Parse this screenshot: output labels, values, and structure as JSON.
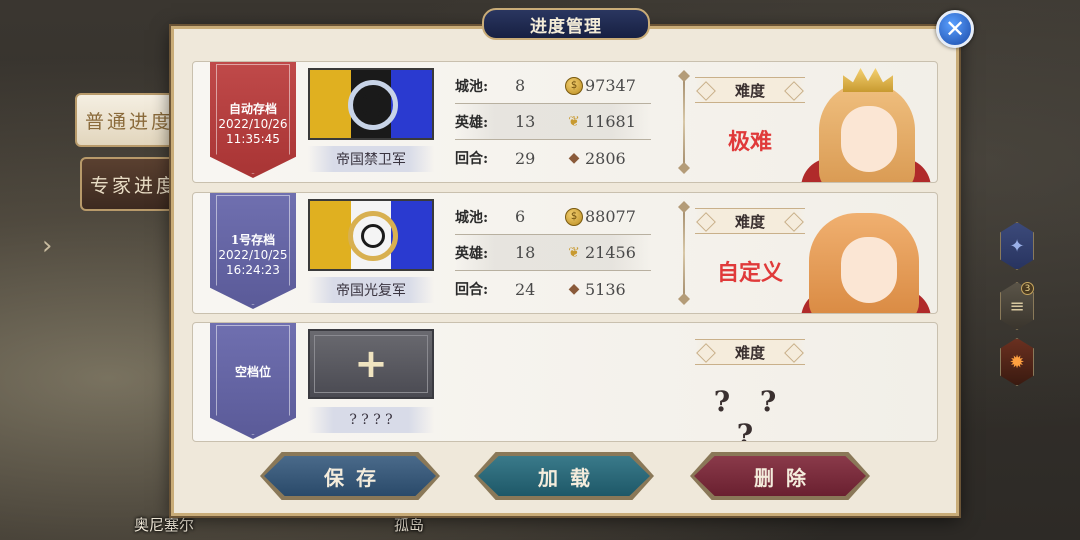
{
  "title": "进度管理",
  "close_icon": "close-icon",
  "side_tabs": {
    "normal": "普通进度",
    "expert": "专家进度"
  },
  "map_labels": {
    "city1": "奥尼塞尔",
    "city2": "孤岛"
  },
  "right_icons": {
    "sword": "sword-icon",
    "scroll": "scroll-icon",
    "scroll_badge": "3",
    "fire": "fire-icon"
  },
  "labels": {
    "cities": "城池:",
    "heroes": "英雄:",
    "turns": "回合:",
    "difficulty": "难度"
  },
  "slots": [
    {
      "name": "自动存档",
      "date": "2022/10/26",
      "time": "11:35:45",
      "ribbon_color": "#b83c3c",
      "faction": "帝国禁卫军",
      "cities": "8",
      "heroes": "13",
      "turns": "29",
      "gold": "97347",
      "food": "11681",
      "wood": "2806",
      "difficulty": "极难",
      "difficulty_color": "#e03a3a"
    },
    {
      "name": "1号存档",
      "date": "2022/10/25",
      "time": "16:24:23",
      "ribbon_color": "#6464a4",
      "faction": "帝国光复军",
      "cities": "6",
      "heroes": "18",
      "turns": "24",
      "gold": "88077",
      "food": "21456",
      "wood": "5136",
      "difficulty": "自定义",
      "difficulty_color": "#e03a3a"
    },
    {
      "name": "空档位",
      "faction": "? ? ? ?",
      "plus": "+",
      "difficulty": "? ? ?"
    }
  ],
  "buttons": {
    "save": "保存",
    "load": "加载",
    "delete": "删除"
  }
}
